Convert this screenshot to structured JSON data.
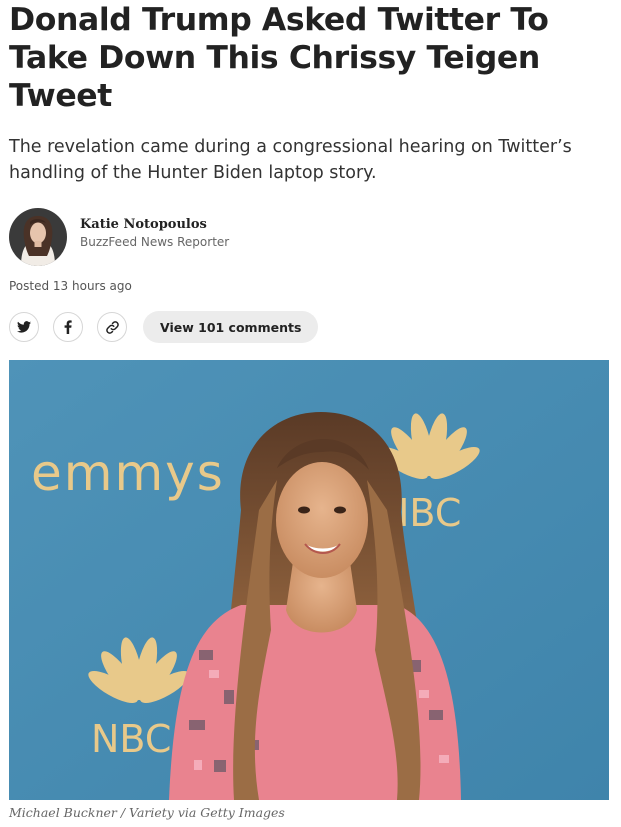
{
  "article": {
    "headline": "Donald Trump Asked Twitter To Take Down This Chrissy Teigen Tweet",
    "dek": "The revelation came during a congressional hearing on Twitter’s handling of the Hunter Biden laptop story."
  },
  "byline": {
    "author": "Katie Notopoulos",
    "role": "BuzzFeed News Reporter",
    "posted": "Posted 13 hours ago"
  },
  "share": {
    "icons": [
      "twitter-icon",
      "facebook-icon",
      "link-icon"
    ],
    "comments_label": "View 101 comments"
  },
  "photo": {
    "backdrop_text_emmys": "emmys",
    "backdrop_logo_1": "NBC",
    "backdrop_logo_2": "NBC",
    "credit": "Michael Buckner / Variety via Getty Images"
  },
  "colors": {
    "backdrop_blue": "#4a8eb3",
    "backdrop_gold": "#e8c98a",
    "button_grey": "#ececec",
    "text": "#222222"
  }
}
